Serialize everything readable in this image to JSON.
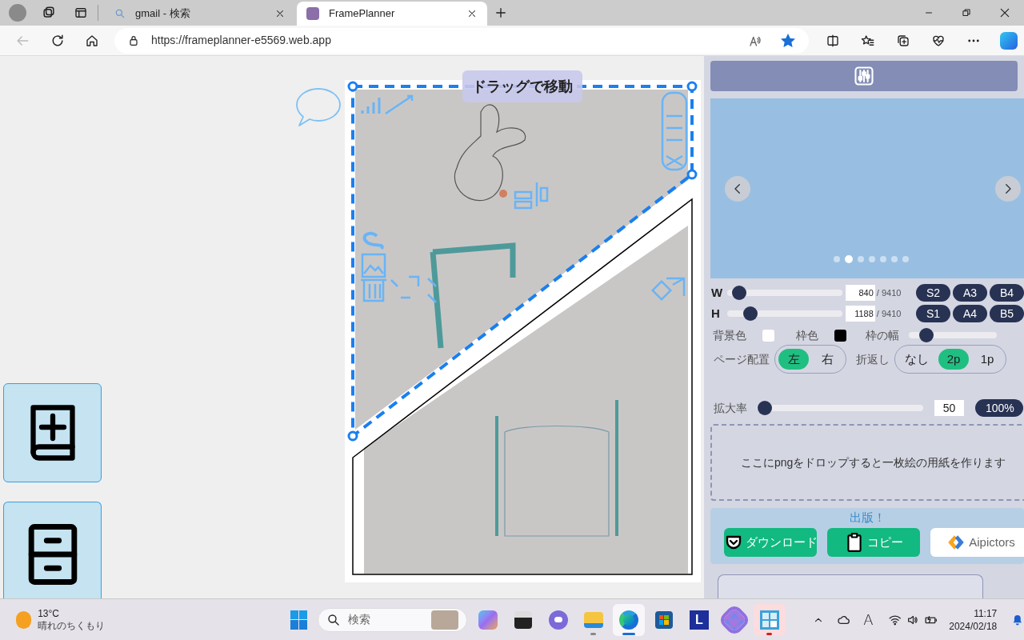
{
  "browser": {
    "tabs": [
      {
        "title": "gmail - 検索",
        "selected": false,
        "kind": "search"
      },
      {
        "title": "FramePlanner",
        "selected": true,
        "kind": "site"
      }
    ],
    "address": "https://frameplanner-e5569.web.app",
    "favorited": true
  },
  "canvas": {
    "hint": "ドラッグで移動"
  },
  "panel": {
    "carousel_dots": [
      {
        "selected": false
      },
      {
        "selected": true
      },
      {
        "selected": false
      },
      {
        "selected": false
      },
      {
        "selected": false
      },
      {
        "selected": false
      },
      {
        "selected": false
      }
    ],
    "size_rows": [
      {
        "label": "W",
        "level": 0.1,
        "value": "840",
        "max": "/ 9410",
        "presets": [
          "S2",
          "A3",
          "B4"
        ]
      },
      {
        "label": "H",
        "level": 0.2,
        "value": "1188",
        "max": "/ 9410",
        "presets": [
          "S1",
          "A4",
          "B5"
        ]
      }
    ],
    "colors": [
      {
        "label": "背景色",
        "color": "#ffffff"
      },
      {
        "label": "枠色",
        "color": "#000000"
      }
    ],
    "border_width": {
      "label": "枠の幅",
      "level": 0.2
    },
    "toggles": [
      {
        "label": "ページ配置",
        "options": [
          {
            "label": "左",
            "selected": true
          },
          {
            "label": "右",
            "selected": false
          }
        ]
      },
      {
        "label": "折返し",
        "options": [
          {
            "label": "なし",
            "selected": false
          },
          {
            "label": "2p",
            "selected": true
          },
          {
            "label": "1p",
            "selected": false
          }
        ]
      }
    ],
    "zoom": {
      "label": "拡大率",
      "level": 0.05,
      "value": "50",
      "button": "100%"
    },
    "drop_zone": "ここにpngをドロップすると一枚絵の用紙を作ります",
    "publish": {
      "title": "出版！",
      "buttons": [
        {
          "label": "ダウンロード",
          "kind": "download"
        },
        {
          "label": "コピー",
          "kind": "copy"
        },
        {
          "label": "Aipictors",
          "kind": "aipictors"
        }
      ]
    }
  },
  "taskbar": {
    "weather": {
      "temp": "13°C",
      "desc": "晴れのちくもり"
    },
    "search_placeholder": "検索",
    "apps": [
      {
        "kind": "copilot",
        "running": false,
        "selected": false,
        "flashing": false
      },
      {
        "kind": "tile",
        "running": false,
        "selected": false,
        "flashing": false
      },
      {
        "kind": "chat",
        "running": false,
        "selected": false,
        "flashing": false
      },
      {
        "kind": "folder",
        "running": true,
        "selected": false,
        "flashing": false
      },
      {
        "kind": "edge",
        "running": true,
        "selected": true,
        "flashing": false
      },
      {
        "kind": "store",
        "running": false,
        "selected": false,
        "flashing": false
      },
      {
        "kind": "letter",
        "label": "L",
        "running": false,
        "selected": false,
        "flashing": false
      },
      {
        "kind": "m365",
        "running": false,
        "selected": false,
        "flashing": false
      },
      {
        "kind": "frameplanner",
        "running": true,
        "selected": false,
        "flashing": true
      }
    ],
    "ime": "A",
    "clock": {
      "time": "11:17",
      "date": "2024/02/18"
    }
  }
}
